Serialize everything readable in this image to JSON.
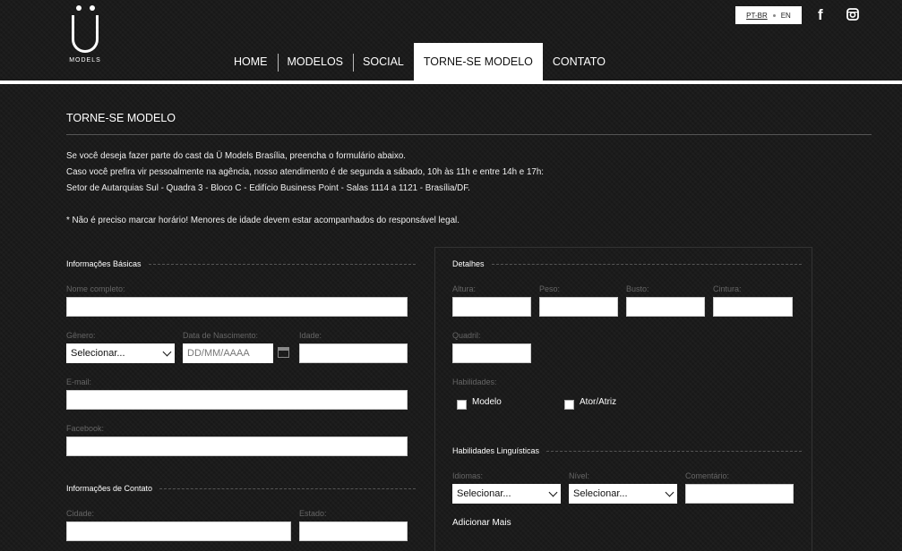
{
  "header": {
    "logo_brand": "MODELS",
    "languages": [
      {
        "label": "PT-BR",
        "active": true
      },
      {
        "label": "EN",
        "active": false
      }
    ],
    "social": [
      {
        "icon": "facebook-icon"
      },
      {
        "icon": "instagram-icon"
      }
    ],
    "nav": [
      {
        "label": "HOME",
        "active": false
      },
      {
        "label": "MODELOS",
        "active": false
      },
      {
        "label": "SOCIAL",
        "active": false
      },
      {
        "label": "TORNE-SE MODELO",
        "active": true
      },
      {
        "label": "CONTATO",
        "active": false
      }
    ]
  },
  "page": {
    "title": "TORNE-SE MODELO",
    "intro": [
      "Se você deseja fazer parte do cast da Ü Models Brasília, preencha o formulário abaixo.",
      "Caso você prefira vir pessoalmente na agência, nosso atendimento é de segunda a sábado, 10h às 11h e entre 14h e 17h:",
      "Setor de Autarquias Sul - Quadra 3 - Bloco C - Edifício Business Point - Salas 1114 a 1121 - Brasília/DF."
    ],
    "note": "* Não é preciso marcar horário! Menores de idade devem estar acompanhados do responsável legal."
  },
  "form": {
    "basic": {
      "title": "Informações Básicas",
      "name_label": "Nome completo:",
      "gender_label": "Gênero:",
      "gender_value": "Selecionar...",
      "birth_label": "Data de Nascimento:",
      "birth_placeholder": "DD/MM/AAAA",
      "age_label": "Idade:",
      "email_label": "E-mail:",
      "facebook_label": "Facebook:"
    },
    "contact": {
      "title": "Informações de Contato",
      "city_label": "Cidade:",
      "state_label": "Estado:"
    },
    "details": {
      "title": "Detalhes",
      "height_label": "Altura:",
      "weight_label": "Peso:",
      "bust_label": "Busto:",
      "waist_label": "Cintura:",
      "hip_label": "Quadril:",
      "skills_label": "Habilidades:",
      "skill_model": "Modelo",
      "skill_actor": "Ator/Atriz"
    },
    "languages": {
      "title": "Habilidades Linguísticas",
      "language_label": "Idiomas:",
      "language_value": "Selecionar...",
      "level_label": "Nível:",
      "level_value": "Selecionar...",
      "comment_label": "Comentário:",
      "add_more": "Adicionar Mais"
    }
  }
}
